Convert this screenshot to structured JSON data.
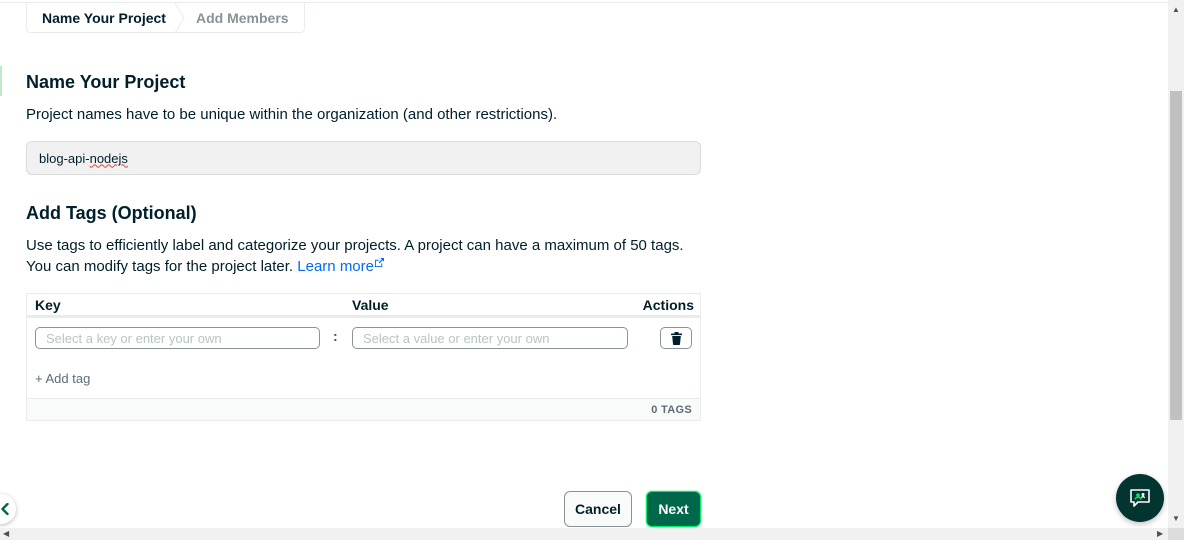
{
  "breadcrumb": {
    "step1": "Name Your Project",
    "step2": "Add Members"
  },
  "name_section": {
    "title": "Name Your Project",
    "description": "Project names have to be unique within the organization (and other restrictions).",
    "input_value_prefix": "blog-api-",
    "input_value_flagged": "nodejs"
  },
  "tags_section": {
    "title": "Add Tags (Optional)",
    "description": "Use tags to efficiently label and categorize your projects. A project can have a maximum of 50 tags. You can modify tags for the project later.",
    "learn_more": "Learn more",
    "columns": {
      "key": "Key",
      "value": "Value",
      "actions": "Actions"
    },
    "key_placeholder": "Select a key or enter your own",
    "value_placeholder": "Select a value or enter your own",
    "separator": ":",
    "add_tag": "+ Add tag",
    "tag_count": "0 TAGS"
  },
  "actions": {
    "cancel": "Cancel",
    "next": "Next"
  },
  "icons": {
    "external_link": "external-link-icon",
    "trash": "trash-icon",
    "back": "chevron-left-icon",
    "chat": "chat-support-icon"
  },
  "colors": {
    "primary_button": "#00684a",
    "link": "#016bf8",
    "chat_fab": "#023430"
  }
}
